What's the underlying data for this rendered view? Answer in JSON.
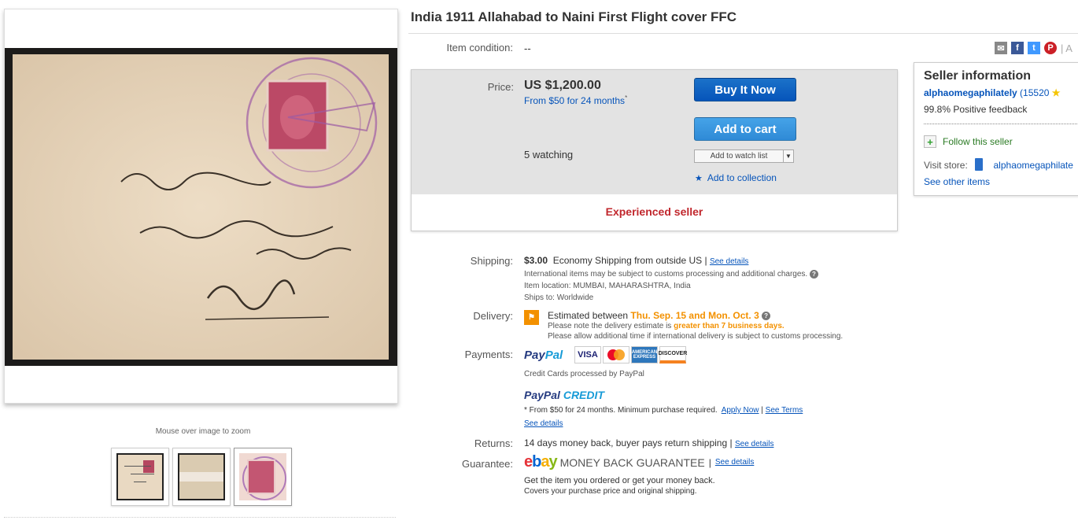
{
  "gallery": {
    "zoom_hint": "Mouse over image to zoom"
  },
  "item": {
    "title": "India 1911 Allahabad to Naini First Flight cover FFC",
    "condition_label": "Item condition:",
    "condition_value": "--"
  },
  "share": {
    "trailing": "A"
  },
  "buybox": {
    "price_label": "Price:",
    "price": "US $1,200.00",
    "finance": "From $50 for 24 months",
    "finance_mark": "*",
    "buy_now": "Buy It Now",
    "add_to_cart": "Add to cart",
    "watching": "5 watching",
    "watch_list": "Add to watch list",
    "add_collection": "Add to collection",
    "experienced": "Experienced seller"
  },
  "seller": {
    "title": "Seller information",
    "name": "alphaomegaphilately",
    "score": "(15520",
    "feedback": "99.8% Positive feedback",
    "follow": "Follow this seller",
    "visit_label": "Visit store:",
    "store_name": "alphaomegaphilate",
    "see_other": "See other items"
  },
  "shipping": {
    "label": "Shipping:",
    "cost": "$3.00",
    "method": "Economy Shipping from outside US",
    "sep": "|",
    "see_details": "See details",
    "customs": "International items may be subject to customs processing and additional charges.",
    "location": "Item location:  MUMBAI, MAHARASHTRA, India",
    "ships_to": "Ships to:  Worldwide"
  },
  "delivery": {
    "label": "Delivery:",
    "estimated": "Estimated between",
    "dates": "Thu. Sep. 15 and Mon. Oct. 3",
    "note1_pre": "Please note the delivery estimate is",
    "note1_em": "greater than 7 business days.",
    "note2": "Please allow additional time if international delivery is subject to customs processing."
  },
  "payments": {
    "label": "Payments:",
    "paypal_a": "Pay",
    "paypal_b": "Pal",
    "cards_visa": "VISA",
    "cards_amex": "AMERICAN EXPRESS",
    "cards_disc": "DISCOVER",
    "processed": "Credit Cards processed by PayPal",
    "credit_logo_a": "PayPal",
    "credit_logo_b": "CREDIT",
    "credit_terms": "* From $50 for 24 months. Minimum purchase required.",
    "apply_now": "Apply Now",
    "see_terms": "See Terms",
    "see_details": "See details"
  },
  "returns": {
    "label": "Returns:",
    "text": "14 days money back, buyer pays return shipping",
    "sep": "|",
    "see_details": "See details"
  },
  "guarantee": {
    "label": "Guarantee:",
    "mbg": "MONEY BACK GUARANTEE",
    "sep": "|",
    "see_details": "See details",
    "line1": "Get the item you ordered or get your money back.",
    "line2": "Covers your purchase price and original shipping."
  }
}
